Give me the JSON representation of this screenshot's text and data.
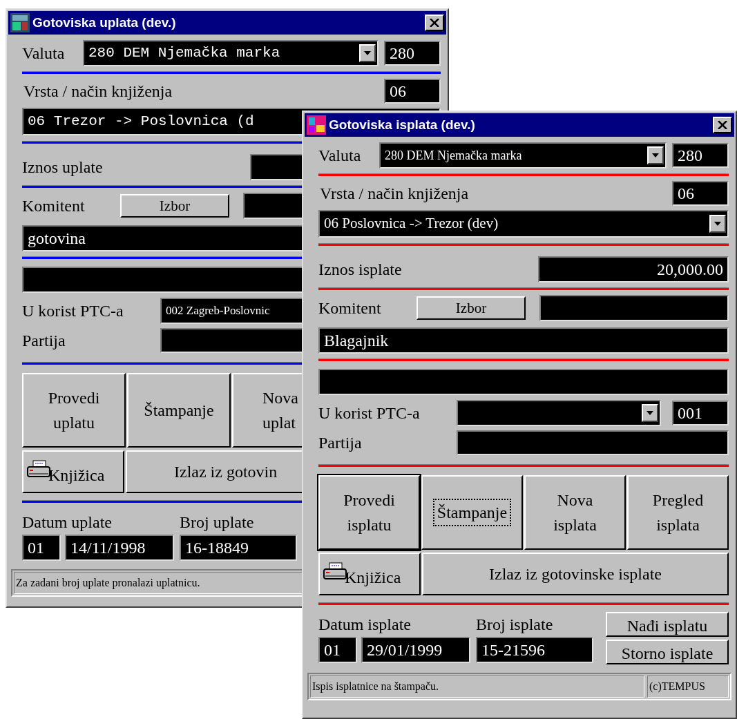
{
  "windows": [
    {
      "title": "Gotoviska uplata (dev.)",
      "valuta": {
        "label": "Valuta",
        "value": "280 DEM Njemačka marka",
        "code": "280"
      },
      "vrsta": {
        "label": "Vrsta / način knjiženja",
        "code": "06",
        "value": "06 Trezor -> Poslovnica (d"
      },
      "iznos": {
        "label": "Iznos uplate"
      },
      "komitent": {
        "label": "Komitent",
        "button": "Izbor",
        "name": "gotovina"
      },
      "ptc": {
        "label": "U korist PTC-a",
        "value": "002 Zagreb-Poslovnic"
      },
      "partija": {
        "label": "Partija"
      },
      "actions": [
        {
          "label": "Provedi uplatu",
          "default": false,
          "focused": false
        },
        {
          "label": "Štampanje",
          "default": false,
          "focused": false
        },
        {
          "label": "Nova uplat",
          "default": false,
          "focused": false
        }
      ],
      "book": "Knjižica",
      "exit": "Izlaz iz gotovin",
      "datum": {
        "label": "Datum uplate",
        "day": "01",
        "date": "14/11/1998"
      },
      "broj": {
        "label": "Broj uplate",
        "value": "16-18849"
      },
      "status": {
        "message": "Za zadani broj uplate pronalazi uplatnicu."
      }
    },
    {
      "title": "Gotoviska isplata (dev.)",
      "valuta": {
        "label": "Valuta",
        "value": "280 DEM Njemačka marka",
        "code": "280"
      },
      "vrsta": {
        "label": "Vrsta / način knjiženja",
        "code": "06",
        "value": "06 Poslovnica -> Trezor (dev)"
      },
      "iznos": {
        "label": "Iznos isplate",
        "value": "20,000.00"
      },
      "komitent": {
        "label": "Komitent",
        "button": "Izbor",
        "name": "Blagajnik"
      },
      "ptc": {
        "label": "U korist PTC-a",
        "code": "001"
      },
      "partija": {
        "label": "Partija"
      },
      "actions": [
        {
          "label": "Provedi isplatu",
          "default": true,
          "focused": false
        },
        {
          "label": "Štampanje",
          "default": false,
          "focused": true
        },
        {
          "label": "Nova isplata",
          "default": false,
          "focused": false
        },
        {
          "label": "Pregled isplata",
          "default": false,
          "focused": false
        }
      ],
      "book": "Knjižica",
      "exit": "Izlaz iz gotovinske isplate",
      "datum": {
        "label": "Datum isplate",
        "day": "01",
        "date": "29/01/1999"
      },
      "broj": {
        "label": "Broj isplate",
        "value": "15-21596"
      },
      "side_buttons": [
        "Nađi isplatu",
        "Storno isplate"
      ],
      "status": {
        "message": "Ispis isplatnice na štampaču.",
        "copyright": "(c)TEMPUS"
      }
    }
  ]
}
